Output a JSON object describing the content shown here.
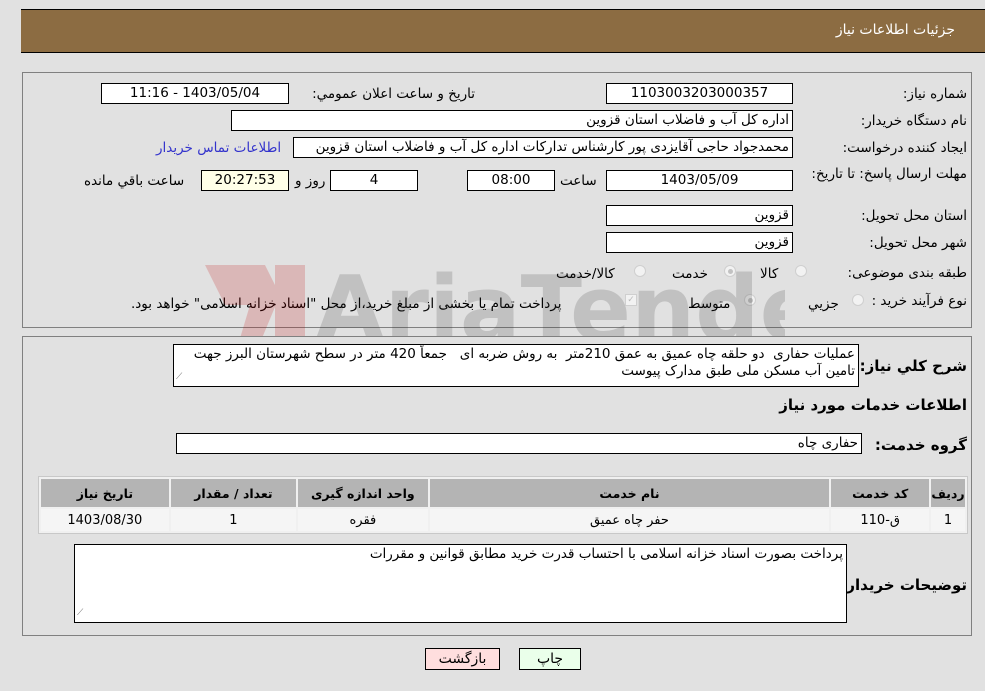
{
  "header": {
    "title": "جزئیات اطلاعات نیاز"
  },
  "fields": {
    "need_number_label": "شماره نیاز:",
    "need_number": "1103003203000357",
    "announce_label": "تاریخ و ساعت اعلان عمومي:",
    "announce_value": "1403/05/04 - 11:16",
    "buyer_org_label": "نام دستگاه خریدار:",
    "buyer_org": "اداره کل آب و فاضلاب استان قزوین",
    "creator_label": "ایجاد کننده درخواست:",
    "creator": "محمدجواد حاجی آقایزدی پور کارشناس تدارکات اداره کل آب و فاضلاب استان قزوین",
    "contact_link": "اطلاعات تماس خریدار",
    "deadline_label": "مهلت ارسال پاسخ: تا تاریخ:",
    "deadline_date": "1403/05/09",
    "time_label": "ساعت",
    "deadline_time": "08:00",
    "days_value": "4",
    "days_label": "روز و",
    "remaining_time": "20:27:53",
    "remaining_label": "ساعت باقي مانده",
    "province_label": "استان محل تحویل:",
    "province": "قزوین",
    "city_label": "شهر محل تحویل:",
    "city": "قزوین",
    "category_label": "طبقه بندی موضوعی:",
    "category_options": [
      "کالا",
      "خدمت",
      "کالا/خدمت"
    ],
    "category_selected": "خدمت",
    "purchase_type_label": "نوع فرآیند خرید :",
    "purchase_type_options": [
      "جزیي",
      "متوسط"
    ],
    "purchase_type_selected": "متوسط",
    "treasury_note": "پرداخت تمام یا بخشی از مبلغ خرید،از محل \"اسناد خزانه اسلامی\" خواهد بود."
  },
  "description": {
    "label": "شرح کلي نیاز:",
    "text": "عملیات حفاری  دو حلقه چاه عمیق به عمق 210متر  به روش ضربه ای   جمعاً 420 متر در سطح شهرستان البرز جهت تامین آب مسکن ملی طبق مدارک پیوست"
  },
  "services": {
    "section_title": "اطلاعات خدمات مورد نیاز",
    "group_label": "گروه خدمت:",
    "group_value": "حفاری چاه",
    "columns": [
      "ردیف",
      "کد خدمت",
      "نام خدمت",
      "واحد اندازه گیری",
      "تعداد / مقدار",
      "تاریخ نیاز"
    ],
    "rows": [
      [
        "1",
        "ق-110",
        "حفر چاه عمیق",
        "فقره",
        "1",
        "1403/08/30"
      ]
    ]
  },
  "buyer_notes": {
    "label": "توضیحات خریدار:",
    "text": "پرداخت بصورت اسناد خزانه اسلامی با احتساب قدرت خرید مطابق قوانین و مقررات"
  },
  "buttons": {
    "print": "چاپ",
    "back": "بازگشت"
  },
  "watermark": {
    "text": "AriaTender.neT"
  },
  "colors": {
    "header_bg": "#8c6c42",
    "print_bg": "#eaffea",
    "back_bg": "#ffdede",
    "link": "#3333cc"
  }
}
